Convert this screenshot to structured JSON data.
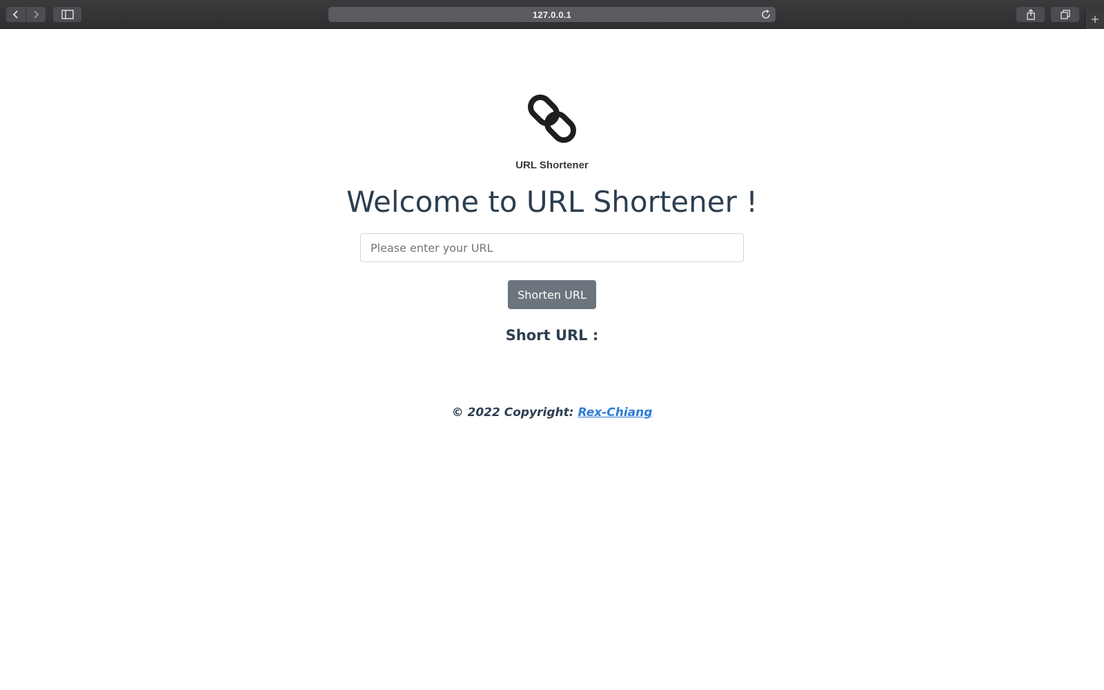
{
  "browser": {
    "address": "127.0.0.1",
    "icons": {
      "back": "chevron-left-icon",
      "forward": "chevron-right-icon",
      "sidebar": "sidebar-icon",
      "reload": "reload-icon",
      "share": "share-icon",
      "tabs": "tabs-overview-icon",
      "new_tab": "plus-icon"
    }
  },
  "app": {
    "logo_icon": "chain-link-icon",
    "logo_caption": "URL Shortener",
    "title": "Welcome to URL Shortener !",
    "input": {
      "placeholder": "Please enter your URL",
      "value": ""
    },
    "submit_label": "Shorten URL",
    "short_url_label": "Short URL :",
    "footer": {
      "prefix": "© 2022 Copyright: ",
      "author_link": "Rex-Chiang"
    }
  },
  "colors": {
    "title_text": "#2c3e50",
    "button_bg": "#6c757d",
    "link": "#2e7bd6"
  }
}
